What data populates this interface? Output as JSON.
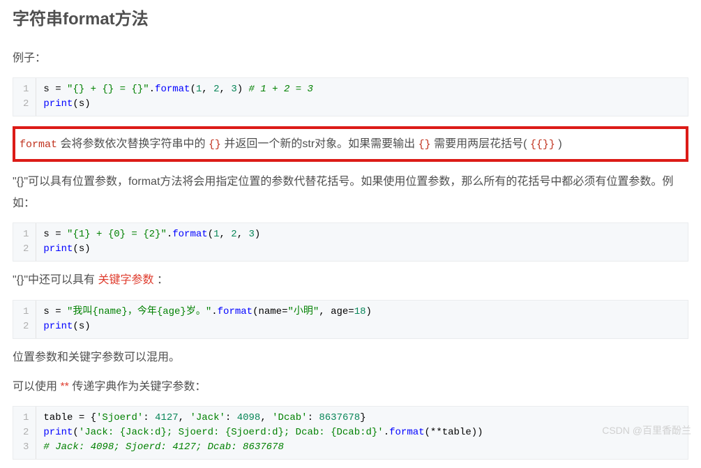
{
  "heading": "字符串format方法",
  "para1": "例子：",
  "block1": {
    "lines": [
      "1",
      "2"
    ],
    "code": [
      {
        "segs": [
          {
            "t": "s = ",
            "c": "tok-n"
          },
          {
            "t": "\"{} + {} = {}\"",
            "c": "tok-s"
          },
          {
            "t": ".",
            "c": "tok-p"
          },
          {
            "t": "format",
            "c": "tok-f"
          },
          {
            "t": "(",
            "c": "tok-p"
          },
          {
            "t": "1",
            "c": "tok-num"
          },
          {
            "t": ", ",
            "c": "tok-p"
          },
          {
            "t": "2",
            "c": "tok-num"
          },
          {
            "t": ", ",
            "c": "tok-p"
          },
          {
            "t": "3",
            "c": "tok-num"
          },
          {
            "t": ") ",
            "c": "tok-p"
          },
          {
            "t": "# 1 + 2 = 3",
            "c": "tok-cm"
          }
        ]
      },
      {
        "segs": [
          {
            "t": "print",
            "c": "tok-f"
          },
          {
            "t": "(s)",
            "c": "tok-p"
          }
        ]
      }
    ]
  },
  "hl": [
    {
      "t": "format",
      "c": "inline-code"
    },
    {
      "t": " 会将参数依次替换字符串中的 ",
      "c": ""
    },
    {
      "t": "{}",
      "c": "inline-code"
    },
    {
      "t": " 并返回一个新的str对象。如果需要输出 ",
      "c": ""
    },
    {
      "t": "{}",
      "c": "inline-code"
    },
    {
      "t": " 需要用两层花括号( ",
      "c": ""
    },
    {
      "t": "{{}}",
      "c": "inline-code"
    },
    {
      "t": " )",
      "c": ""
    }
  ],
  "para3": "\"{}\"可以具有位置参数，format方法将会用指定位置的参数代替花括号。如果使用位置参数，那么所有的花括号中都必须有位置参数。例如：",
  "block2": {
    "lines": [
      "1",
      "2"
    ],
    "code": [
      {
        "segs": [
          {
            "t": "s = ",
            "c": "tok-n"
          },
          {
            "t": "\"{1} + {0} = {2}\"",
            "c": "tok-s"
          },
          {
            "t": ".",
            "c": "tok-p"
          },
          {
            "t": "format",
            "c": "tok-f"
          },
          {
            "t": "(",
            "c": "tok-p"
          },
          {
            "t": "1",
            "c": "tok-num"
          },
          {
            "t": ", ",
            "c": "tok-p"
          },
          {
            "t": "2",
            "c": "tok-num"
          },
          {
            "t": ", ",
            "c": "tok-p"
          },
          {
            "t": "3",
            "c": "tok-num"
          },
          {
            "t": ")",
            "c": "tok-p"
          }
        ]
      },
      {
        "segs": [
          {
            "t": "print",
            "c": "tok-f"
          },
          {
            "t": "(s)",
            "c": "tok-p"
          }
        ]
      }
    ]
  },
  "para4_pre": "\"{}\"中还可以具有 ",
  "para4_kw": "关键字参数",
  "para4_post": " ：",
  "block3": {
    "lines": [
      "1",
      "2"
    ],
    "code": [
      {
        "segs": [
          {
            "t": "s = ",
            "c": "tok-n"
          },
          {
            "t": "\"我叫{name}，今年{age}岁。\"",
            "c": "tok-s"
          },
          {
            "t": ".",
            "c": "tok-p"
          },
          {
            "t": "format",
            "c": "tok-f"
          },
          {
            "t": "(name=",
            "c": "tok-p"
          },
          {
            "t": "\"小明\"",
            "c": "tok-s"
          },
          {
            "t": ", age=",
            "c": "tok-p"
          },
          {
            "t": "18",
            "c": "tok-num"
          },
          {
            "t": ")",
            "c": "tok-p"
          }
        ]
      },
      {
        "segs": [
          {
            "t": "print",
            "c": "tok-f"
          },
          {
            "t": "(s)",
            "c": "tok-p"
          }
        ]
      }
    ]
  },
  "para5": "位置参数和关键字参数可以混用。",
  "para6_pre": "可以使用 ",
  "para6_kw": "**",
  "para6_post": " 传递字典作为关键字参数：",
  "block4": {
    "lines": [
      "1",
      "2",
      "3"
    ],
    "code": [
      {
        "segs": [
          {
            "t": "table = {",
            "c": "tok-n"
          },
          {
            "t": "'Sjoerd'",
            "c": "tok-s"
          },
          {
            "t": ": ",
            "c": "tok-p"
          },
          {
            "t": "4127",
            "c": "tok-num"
          },
          {
            "t": ", ",
            "c": "tok-p"
          },
          {
            "t": "'Jack'",
            "c": "tok-s"
          },
          {
            "t": ": ",
            "c": "tok-p"
          },
          {
            "t": "4098",
            "c": "tok-num"
          },
          {
            "t": ", ",
            "c": "tok-p"
          },
          {
            "t": "'Dcab'",
            "c": "tok-s"
          },
          {
            "t": ": ",
            "c": "tok-p"
          },
          {
            "t": "8637678",
            "c": "tok-num"
          },
          {
            "t": "}",
            "c": "tok-p"
          }
        ]
      },
      {
        "segs": [
          {
            "t": "print",
            "c": "tok-f"
          },
          {
            "t": "(",
            "c": "tok-p"
          },
          {
            "t": "'Jack: {Jack:d}; Sjoerd: {Sjoerd:d}; Dcab: {Dcab:d}'",
            "c": "tok-s"
          },
          {
            "t": ".",
            "c": "tok-p"
          },
          {
            "t": "format",
            "c": "tok-f"
          },
          {
            "t": "(**table))",
            "c": "tok-p"
          }
        ]
      },
      {
        "segs": [
          {
            "t": "# Jack: 4098; Sjoerd: 4127; Dcab: 8637678",
            "c": "tok-cm"
          }
        ]
      }
    ]
  },
  "watermark": "CSDN @百里香酚兰"
}
